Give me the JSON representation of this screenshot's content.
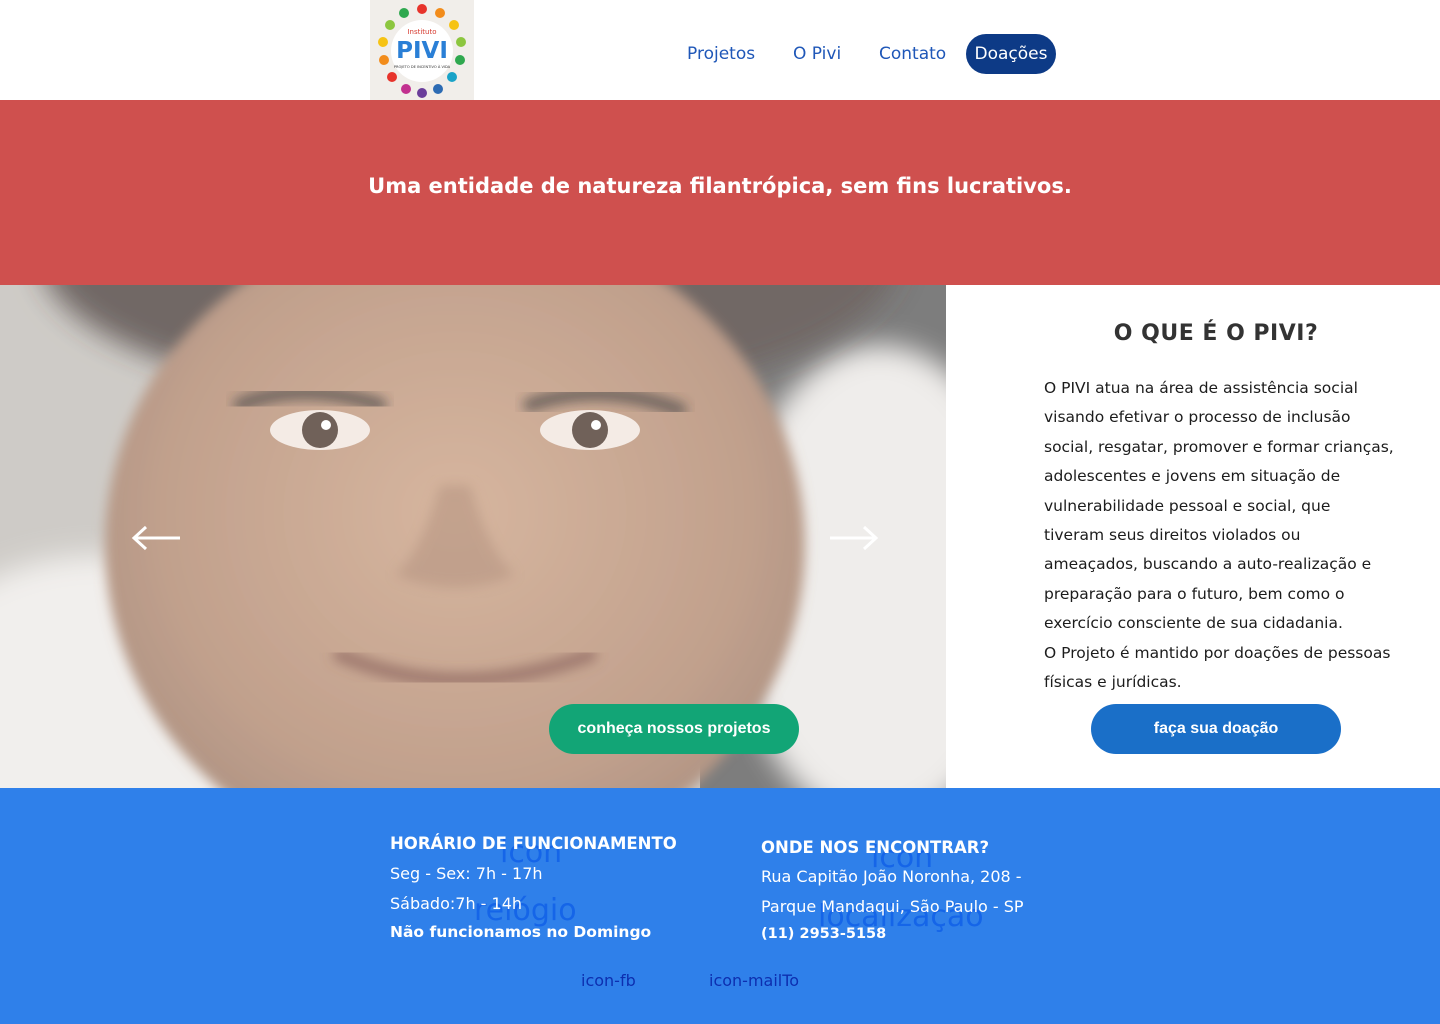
{
  "header": {
    "logo": {
      "top_text": "Instituto",
      "main_text": "PIVI",
      "bottom_text": "PROJETO DE INCENTIVO À VIDA"
    },
    "nav": [
      {
        "label": "Projetos"
      },
      {
        "label": "O Pivi"
      },
      {
        "label": "Contato"
      },
      {
        "label": "Doações"
      }
    ]
  },
  "banner": {
    "tagline": "Uma entidade de natureza filantrópica, sem fins lucrativos."
  },
  "carousel": {
    "prev_icon": "arrow-left-icon",
    "next_icon": "arrow-right-icon",
    "cta_label": "conheça nossos projetos"
  },
  "about": {
    "title": "O QUE É O PIVI?",
    "paragraph_1": "O PIVI atua na área de assistência social visando efetivar o processo de inclusão social, resgatar, promover e formar crianças, adolescentes e jovens em situação de vulnerabilidade pessoal e social, que tiveram seus direitos violados ou ameaçados, buscando a auto-realização e preparação para o futuro, bem como o exercício consciente de sua cidadania.",
    "paragraph_2": "O Projeto é mantido por doações de pessoas físicas e jurídicas.",
    "cta_label": "faça sua doação"
  },
  "footer": {
    "clock_alt_1": "icon",
    "clock_alt_2": "relógio",
    "location_alt_1": "icon",
    "location_alt_2": "localização",
    "hours": {
      "title": "HORÁRIO DE FUNCIONAMENTO",
      "line_1": "Seg - Sex: 7h - 17h",
      "line_2": "Sábado:7h - 14h",
      "line_3": "Não funcionamos no Domingo"
    },
    "location": {
      "title": "ONDE NOS ENCONTRAR?",
      "line_1": "Rua Capitão João Noronha, 208 -",
      "line_2": "Parque Mandaqui, São Paulo - SP",
      "phone": "(11) 2953-5158"
    },
    "social": {
      "facebook": "icon-fb",
      "mail": "icon-mailTo"
    }
  },
  "colors": {
    "banner": "#cf504e",
    "nav_active": "#0d3a86",
    "green_button": "#12a576",
    "blue_button": "#1a6fc8",
    "footer": "#2f80ea"
  }
}
